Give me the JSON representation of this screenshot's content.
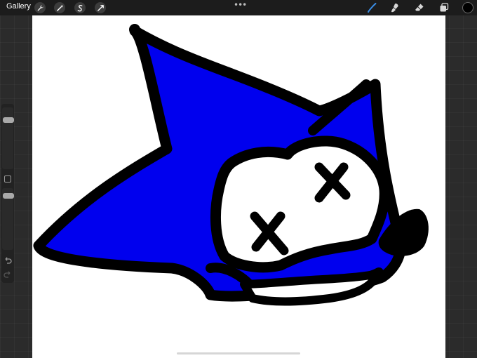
{
  "topbar": {
    "gallery_label": "Gallery",
    "left_tools": [
      "wrench-icon",
      "magic-wand-icon",
      "selection-icon",
      "transform-icon"
    ],
    "more_label": "•••",
    "right_tools": [
      "brush-icon",
      "smudge-icon",
      "eraser-icon",
      "layers-icon"
    ],
    "current_color": "#000000",
    "active_tool_color": "#3a8ee8"
  },
  "canvas": {
    "background": "#ffffff",
    "fill_color": "#0000ee",
    "stroke_color": "#000000"
  },
  "sidebar": {
    "controls": [
      "brush-size-slider",
      "modify-button",
      "opacity-slider",
      "undo-icon",
      "redo-icon"
    ]
  }
}
